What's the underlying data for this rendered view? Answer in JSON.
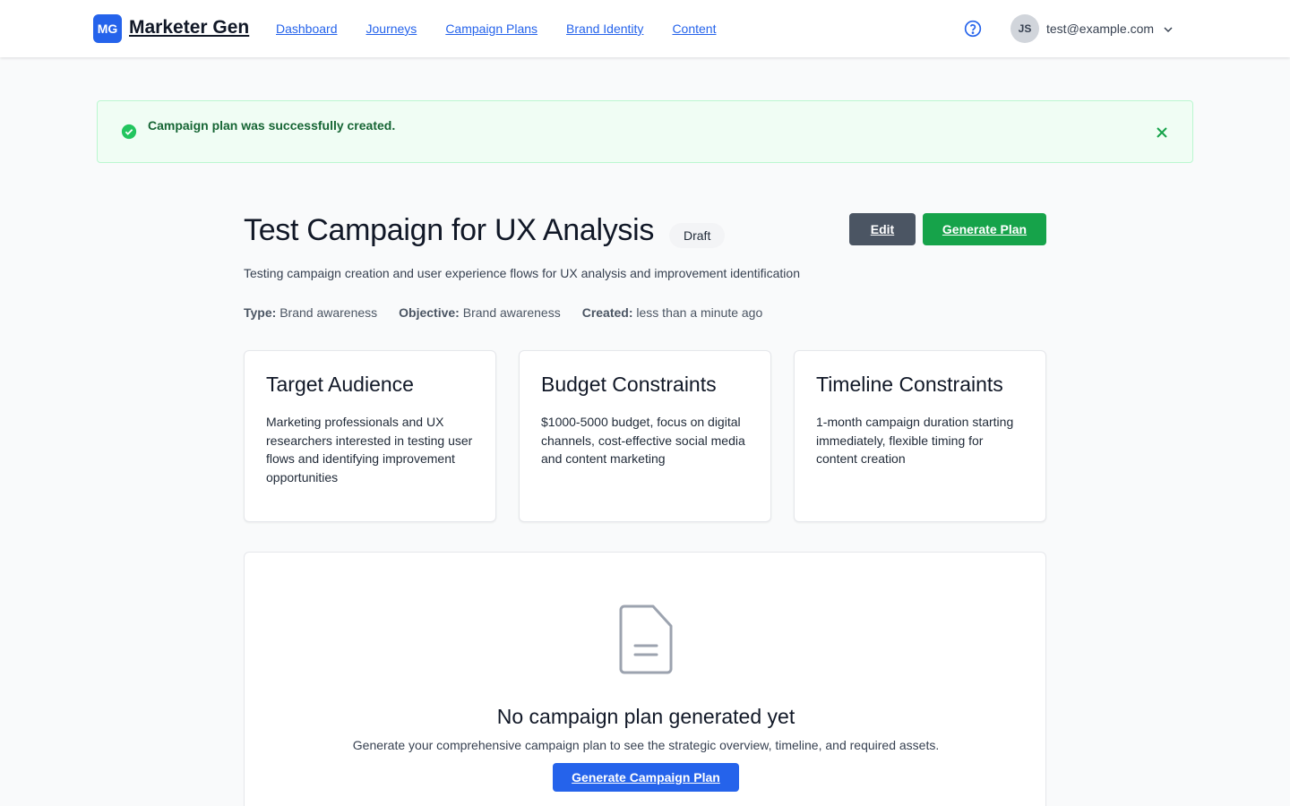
{
  "header": {
    "logo_badge": "MG",
    "logo_text": "Marketer Gen",
    "nav": [
      "Dashboard",
      "Journeys",
      "Campaign Plans",
      "Brand Identity",
      "Content"
    ],
    "user_initials": "JS",
    "user_email": "test@example.com"
  },
  "flash": {
    "message": "Campaign plan was successfully created."
  },
  "campaign": {
    "title": "Test Campaign for UX Analysis",
    "status": "Draft",
    "edit_label": "Edit",
    "generate_label": "Generate Plan",
    "description": "Testing campaign creation and user experience flows for UX analysis and improvement identification",
    "meta": {
      "type_label": "Type:",
      "type_value": "Brand awareness",
      "objective_label": "Objective:",
      "objective_value": "Brand awareness",
      "created_label": "Created:",
      "created_value": "less than a minute ago"
    }
  },
  "cards": [
    {
      "title": "Target Audience",
      "body": "Marketing professionals and UX researchers interested in testing user flows and identifying improvement opportunities"
    },
    {
      "title": "Budget Constraints",
      "body": "$1000-5000 budget, focus on digital channels, cost-effective social media and content marketing"
    },
    {
      "title": "Timeline Constraints",
      "body": "1-month campaign duration starting immediately, flexible timing for content creation"
    }
  ],
  "empty_plan": {
    "title": "No campaign plan generated yet",
    "text": "Generate your comprehensive campaign plan to see the strategic overview, timeline, and required assets.",
    "button_label": "Generate Campaign Plan"
  },
  "colors": {
    "primary": "#2563eb",
    "success": "#16a34a",
    "secondary": "#4b5563",
    "flash_bg": "#f0fdf4"
  }
}
